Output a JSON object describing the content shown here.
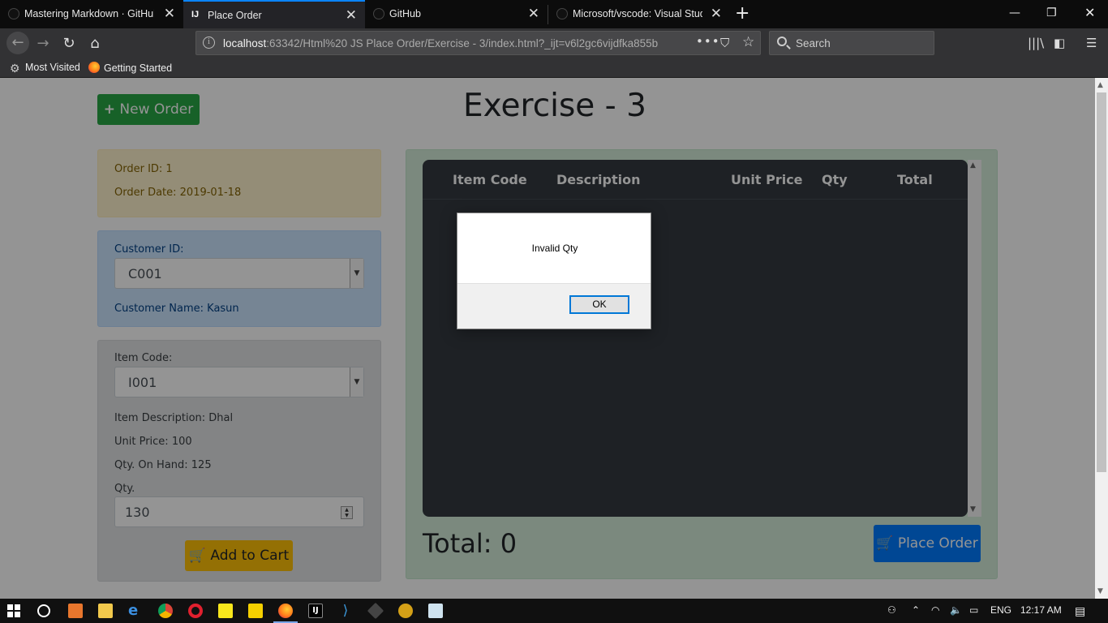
{
  "browser": {
    "tabs": [
      {
        "title": "Mastering Markdown · GitHub",
        "active": false
      },
      {
        "title": "Place Order",
        "active": true
      },
      {
        "title": "GitHub",
        "active": false
      },
      {
        "title": "Microsoft/vscode: Visual Studio",
        "active": false
      }
    ],
    "url_host": "localhost",
    "url_rest": ":63342/Html%20 JS Place Order/Exercise - 3/index.html?_ijt=v6l2gc6vijdfka855b",
    "search_placeholder": "Search",
    "bookmarks": [
      {
        "label": "Most Visited",
        "icon": "gear-icon"
      },
      {
        "label": "Getting Started",
        "icon": "firefox-icon"
      }
    ]
  },
  "page": {
    "new_order_label": "New Order",
    "title": "Exercise - 3",
    "order": {
      "id_text": "Order ID: 1",
      "date_text": "Order Date: 2019-01-18"
    },
    "customer": {
      "id_label": "Customer ID:",
      "id_value": "C001",
      "name_text": "Customer Name: Kasun"
    },
    "item": {
      "code_label": "Item Code:",
      "code_value": "I001",
      "description_text": "Item Description: Dhal",
      "unit_price_text": "Unit Price: 100",
      "qty_on_hand_text": "Qty. On Hand: 125",
      "qty_label": "Qty.",
      "qty_value": "130",
      "add_to_cart_label": "Add to Cart"
    },
    "cart": {
      "headers": [
        "Item Code",
        "Description",
        "Unit Price",
        "Qty",
        "Total"
      ],
      "rows": [],
      "total_text": "Total: 0",
      "place_order_label": "Place Order"
    }
  },
  "alert": {
    "message": "Invalid Qty",
    "ok_label": "OK"
  },
  "taskbar": {
    "lang": "ENG",
    "time": "12:17 AM"
  },
  "colors": {
    "success": "#28a745",
    "warning": "#ffc107",
    "primary": "#007bff",
    "table_dark": "#343a40",
    "accent_tab": "#0a84ff"
  }
}
